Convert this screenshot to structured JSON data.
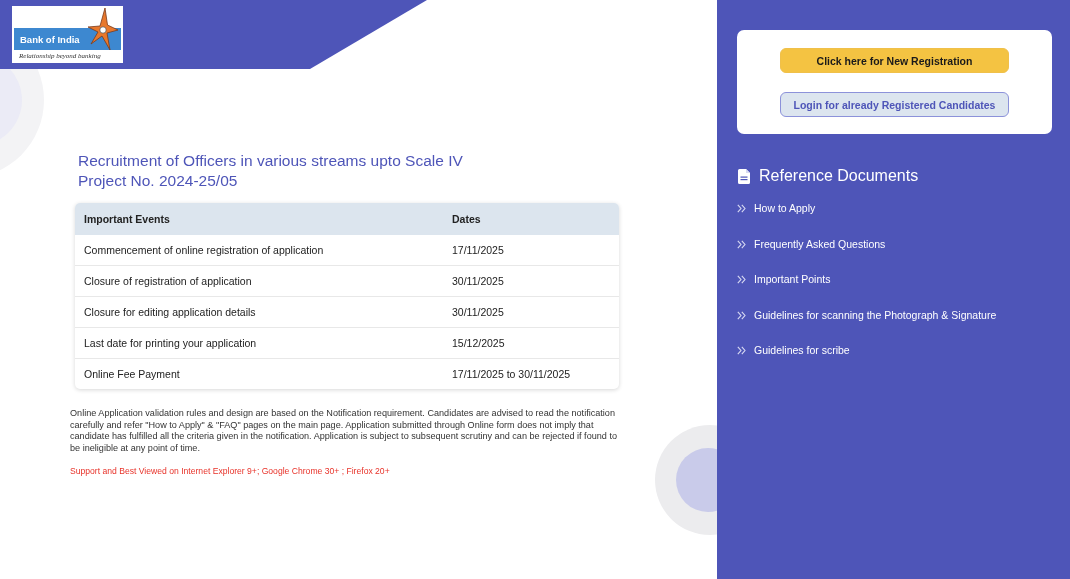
{
  "header": {
    "logo": {
      "name": "Bank of India",
      "tagline": "Relationship beyond banking"
    }
  },
  "notice": {
    "title": "Recruitment of Officers in various streams upto Scale IV",
    "project_no": "Project No. 2024-25/05"
  },
  "table": {
    "columns": [
      "Important Events",
      "Dates"
    ],
    "rows": [
      [
        "Commencement of online registration of application",
        "17/11/2025"
      ],
      [
        "Closure of registration of application",
        "30/11/2025"
      ],
      [
        "Closure for editing application details",
        "30/11/2025"
      ],
      [
        "Last date for printing your application",
        "15/12/2025"
      ],
      [
        "Online Fee Payment",
        "17/11/2025 to 30/11/2025"
      ]
    ]
  },
  "disclaimer": "Online Application validation rules and design are based on the Notification requirement. Candidates are advised to read the notification carefully and refer \"How to Apply\" & \"FAQ\" pages on the main page. Application submitted through Online form does not imply that candidate has fulfilled all the criteria given in the notification. Application is subject to subsequent scrutiny and can be rejected if found to be ineligible at any point of time.",
  "browser_support": "Support and Best Viewed on Internet Explorer 9+; Google Chrome 30+ ; Firefox 20+",
  "sidebar": {
    "buttons": [
      {
        "label": "Click here for New Registration",
        "kind": "primary"
      },
      {
        "label": "Login for already Registered Candidates",
        "kind": "secondary"
      }
    ],
    "reference_documents": {
      "heading": "Reference Documents",
      "items": [
        "How to Apply",
        "Frequently Asked Questions",
        "Important Points",
        "Guidelines for scanning the Photograph & Signature",
        "Guidelines for scribe"
      ]
    }
  }
}
